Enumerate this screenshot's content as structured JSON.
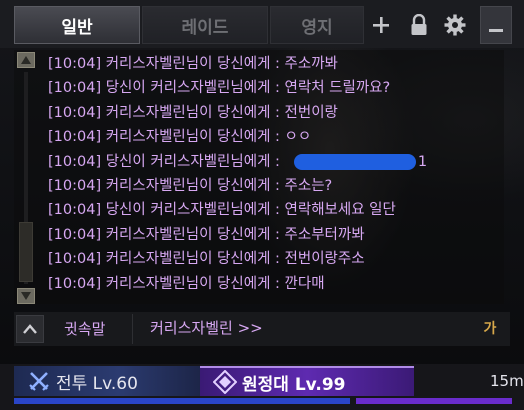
{
  "tabs": [
    {
      "label": "일반",
      "active": true
    },
    {
      "label": "레이드",
      "active": false
    },
    {
      "label": "영지",
      "active": false
    }
  ],
  "tab_actions": {
    "add_icon": "plus-icon",
    "lock_icon": "lock-icon",
    "settings_icon": "gear-icon",
    "minimize_icon": "minimize-icon"
  },
  "chat": {
    "messages": [
      {
        "time": "[10:04]",
        "text": "커리스자벨린님이 당신에게 : 주소까봐",
        "redacted": false
      },
      {
        "time": "[10:04]",
        "text": "당신이 커리스자벨린님에게 : 연락처 드릴까요?",
        "redacted": false
      },
      {
        "time": "[10:04]",
        "text": "커리스자벨린님이 당신에게 : 전번이랑",
        "redacted": false
      },
      {
        "time": "[10:04]",
        "text": "커리스자벨린님이 당신에게 : ㅇㅇ",
        "redacted": false
      },
      {
        "time": "[10:04]",
        "text": "당신이 커리스자벨린님에게 :",
        "redacted": true,
        "suffix": "1"
      },
      {
        "time": "[10:04]",
        "text": "커리스자벨린님이 당신에게 : 주소는?",
        "redacted": false
      },
      {
        "time": "[10:04]",
        "text": "당신이 커리스자벨린님에게 : 연락해보세요 일단",
        "redacted": false
      },
      {
        "time": "[10:04]",
        "text": "커리스자벨린님이 당신에게 : 주소부터까봐",
        "redacted": false
      },
      {
        "time": "[10:04]",
        "text": "커리스자벨린님이 당신에게 : 전번이랑주소",
        "redacted": false
      },
      {
        "time": "[10:04]",
        "text": "커리스자벨린님이 당신에게 : 깐다매",
        "redacted": false
      }
    ],
    "text_color": "#d7a8f2"
  },
  "input": {
    "channel_label": "귓속말",
    "target": "커리스자벨린 >>",
    "ime_indicator": "가"
  },
  "channels": {
    "combat": {
      "label": "전투 Lv.60",
      "icon": "crossed-swords-icon"
    },
    "party": {
      "label": "원정대 Lv.99",
      "icon": "expedition-emblem-icon"
    },
    "time": "15m"
  },
  "colors": {
    "whisper": "#d7a8f2",
    "combat_bar": "#2a45c8",
    "party_bar": "#6a2ccc",
    "ime": "#d7a84a"
  }
}
